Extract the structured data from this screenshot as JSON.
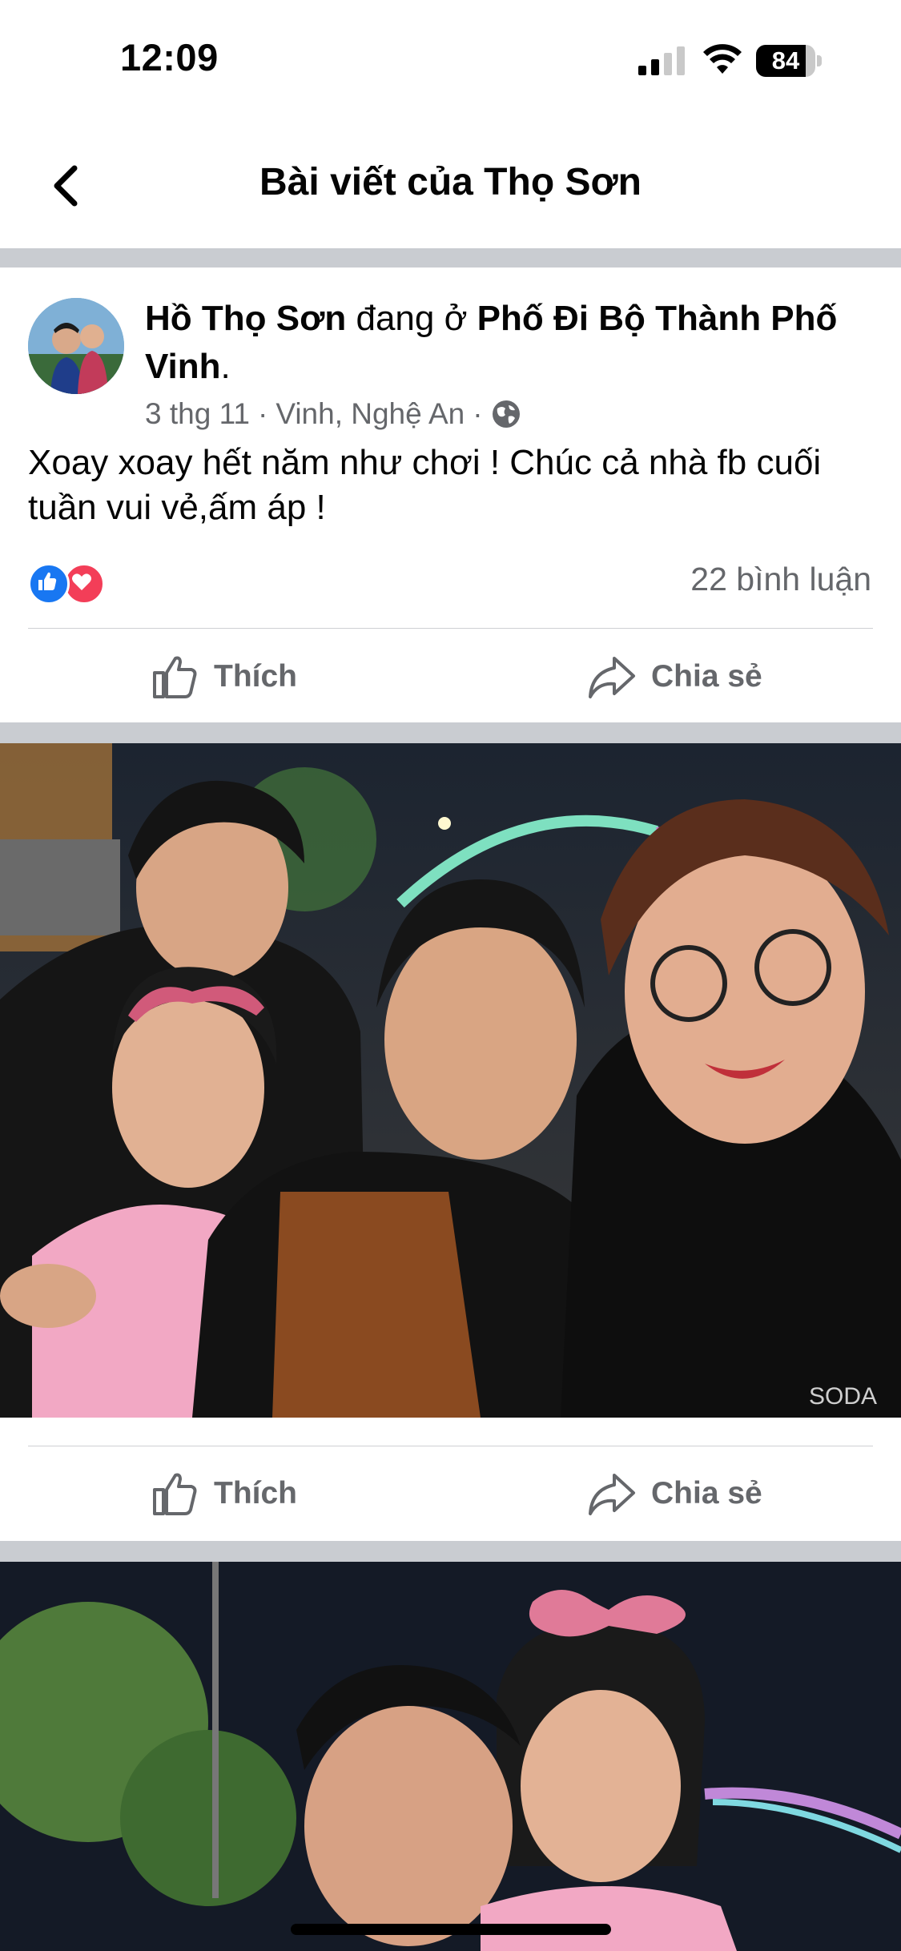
{
  "status_bar": {
    "time": "12:09",
    "battery": "84",
    "battery_level": 0.84
  },
  "nav": {
    "title": "Bài viết của Thọ Sơn",
    "back_icon": "chevron-left-icon"
  },
  "post": {
    "author": "Hồ Thọ Sơn",
    "action_text": " đang ở ",
    "place": "Phố Đi Bộ Thành Phố Vinh",
    "period": ".",
    "date": "3 thg 11",
    "separator": " · ",
    "location": "Vinh, Nghệ An",
    "privacy_icon": "globe-icon",
    "text": "Xoay xoay hết năm như chơi ! Chúc cả nhà fb cuối tuần vui vẻ,ấm áp !",
    "reactions": [
      "like-reaction-icon",
      "love-reaction-icon"
    ],
    "comments_label": "22 bình luận"
  },
  "actions": {
    "like_label": "Thích",
    "share_label": "Chia sẻ"
  },
  "photos": [
    {
      "name": "family-selfie-photo-1",
      "watermark": "SODA"
    },
    {
      "name": "family-selfie-photo-2"
    }
  ],
  "colors": {
    "accent": "#1877f2",
    "love": "#f33e58",
    "secondary_text": "#65676b",
    "divider": "#c9ccd1"
  }
}
